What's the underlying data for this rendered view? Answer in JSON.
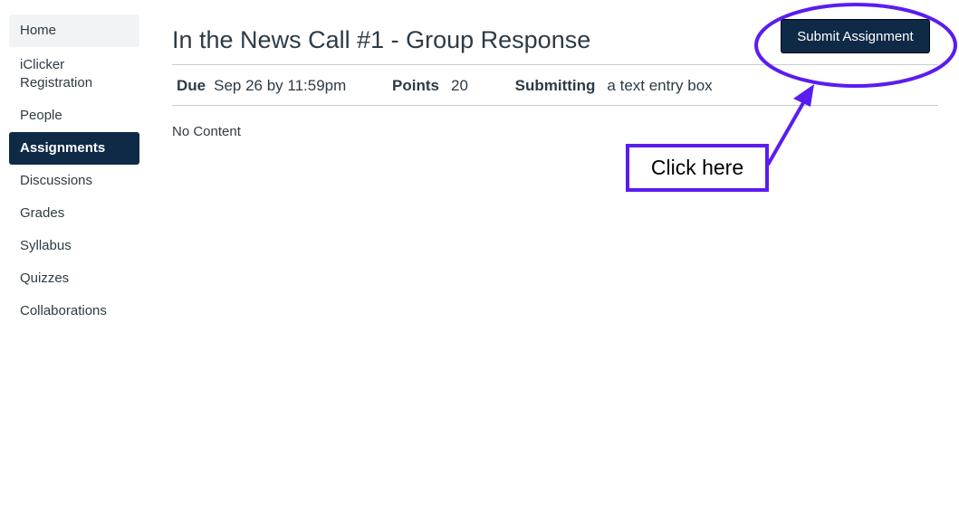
{
  "sidebar": {
    "items": [
      {
        "label": "Home"
      },
      {
        "label": "iClicker Registration"
      },
      {
        "label": "People"
      },
      {
        "label": "Assignments",
        "active": true
      },
      {
        "label": "Discussions"
      },
      {
        "label": "Grades"
      },
      {
        "label": "Syllabus"
      },
      {
        "label": "Quizzes"
      },
      {
        "label": "Collaborations"
      }
    ]
  },
  "assignment": {
    "title": "In the News Call #1 - Group Response",
    "submit_label": "Submit Assignment",
    "due_label": "Due",
    "due_value": "Sep 26 by 11:59pm",
    "points_label": "Points",
    "points_value": "20",
    "submitting_label": "Submitting",
    "submitting_value": "a text entry box",
    "content": "No Content"
  },
  "annotation": {
    "callout_text": "Click here",
    "color": "#5b1cf0"
  },
  "colors": {
    "nav_active_bg": "#0e2a47",
    "text": "#2d3b45"
  }
}
